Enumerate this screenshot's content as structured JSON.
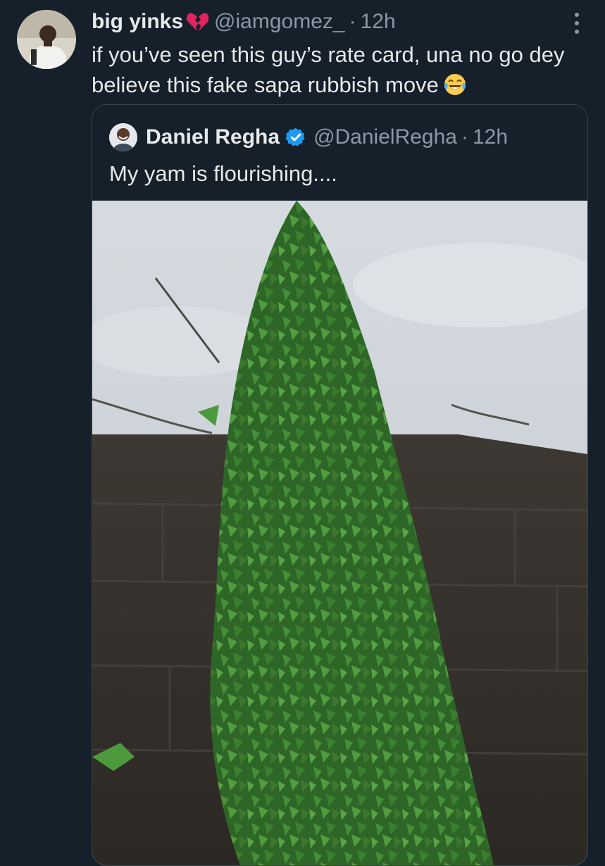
{
  "tweet": {
    "author_name": "big yinks",
    "author_name_emoji": "broken-heart-emoji",
    "handle": "@iamgomez_",
    "time": "12h",
    "text": "if you’ve seen this guy’s rate card, una no go dey believe this fake sapa rubbish move",
    "text_emoji": "face-with-tears-of-joy-emoji"
  },
  "quoted": {
    "author_name": "Daniel Regha",
    "verified": true,
    "handle": "@DanielRegha",
    "time": "12h",
    "text": "My yam is flourishing....",
    "media": "photo of a climbing yam vine growing up a concrete block wall under a cloudy sky"
  },
  "icons": {
    "more": "more-vertical-icon",
    "verified": "verified-badge-icon"
  },
  "colors": {
    "background": "#15202b",
    "primary_text": "#e7e9ea",
    "secondary_text": "#8b98a5",
    "border": "#38444d",
    "verified_blue": "#1d9bf0"
  },
  "separator": "·"
}
